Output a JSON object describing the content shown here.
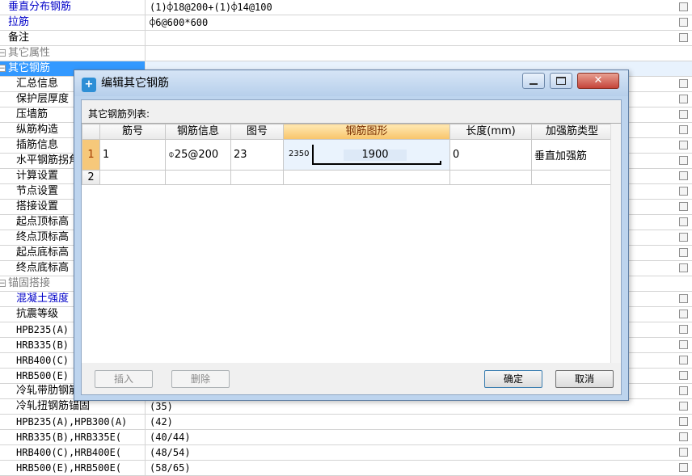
{
  "property_rows": [
    {
      "name": "垂直分布钢筋",
      "value": "(1)⌽18@200+(1)⌽14@100",
      "style": "blue",
      "indent": 10
    },
    {
      "name": "拉筋",
      "value": "⌽6@600*600",
      "style": "blue",
      "indent": 10
    },
    {
      "name": "备注",
      "value": "",
      "style": "",
      "indent": 10
    },
    {
      "name": "其它属性",
      "value": "",
      "style": "grey",
      "indent": 0,
      "toggle": "⊟"
    },
    {
      "name": "其它钢筋",
      "value": "",
      "style": "selected",
      "indent": 0,
      "toggle": "—"
    },
    {
      "name": "汇总信息",
      "value": "",
      "style": "",
      "indent": 20
    },
    {
      "name": "保护层厚度",
      "value": "",
      "style": "",
      "indent": 20
    },
    {
      "name": "压墙筋",
      "value": "",
      "style": "",
      "indent": 20
    },
    {
      "name": "纵筋构造",
      "value": "",
      "style": "",
      "indent": 20
    },
    {
      "name": "插筋信息",
      "value": "",
      "style": "",
      "indent": 20
    },
    {
      "name": "水平钢筋拐角",
      "value": "",
      "style": "",
      "indent": 20
    },
    {
      "name": "计算设置",
      "value": "",
      "style": "",
      "indent": 20
    },
    {
      "name": "节点设置",
      "value": "",
      "style": "",
      "indent": 20
    },
    {
      "name": "搭接设置",
      "value": "",
      "style": "",
      "indent": 20
    },
    {
      "name": "起点顶标高",
      "value": "",
      "style": "",
      "indent": 20
    },
    {
      "name": "终点顶标高",
      "value": "",
      "style": "",
      "indent": 20
    },
    {
      "name": "起点底标高",
      "value": "",
      "style": "",
      "indent": 20
    },
    {
      "name": "终点底标高",
      "value": "",
      "style": "",
      "indent": 20
    },
    {
      "name": "锚固搭接",
      "value": "",
      "style": "grey",
      "indent": 0,
      "toggle": "⊟"
    },
    {
      "name": "混凝土强度",
      "value": "",
      "style": "blue",
      "indent": 20
    },
    {
      "name": "抗震等级",
      "value": "",
      "style": "",
      "indent": 20
    },
    {
      "name": "HPB235(A)",
      "value": "",
      "style": "mono",
      "indent": 20
    },
    {
      "name": "HRB335(B)",
      "value": "",
      "style": "mono",
      "indent": 20
    },
    {
      "name": "HRB400(C)",
      "value": "",
      "style": "mono",
      "indent": 20
    },
    {
      "name": "HRB500(E)",
      "value": "",
      "style": "mono",
      "indent": 20
    },
    {
      "name": "冷轧带肋钢筋",
      "value": "",
      "style": "",
      "indent": 20
    },
    {
      "name": "冷轧扭钢筋锚固",
      "value": "(35)",
      "style": "",
      "indent": 20
    },
    {
      "name": "HPB235(A),HPB300(A)",
      "value": "(42)",
      "style": "mono",
      "indent": 20
    },
    {
      "name": "HRB335(B),HRB335E(",
      "value": "(40/44)",
      "style": "mono",
      "indent": 20
    },
    {
      "name": "HRB400(C),HRB400E(",
      "value": "(48/54)",
      "style": "mono",
      "indent": 20
    },
    {
      "name": "HRB500(E),HRB500E(",
      "value": "(58/65)",
      "style": "mono",
      "indent": 20
    }
  ],
  "dialog": {
    "title": "编辑其它钢筋",
    "list_label": "其它钢筋列表:",
    "columns": [
      "筋号",
      "钢筋信息",
      "图号",
      "钢筋图形",
      "长度(mm)",
      "加强筋类型"
    ],
    "rows": [
      {
        "no": "1",
        "bar_no": "1",
        "rebar_info": "⌽25@200",
        "figure_no": "23",
        "shape_left": "2350",
        "shape_value": "1900",
        "length": "0",
        "type": "垂直加强筋"
      },
      {
        "no": "2",
        "bar_no": "",
        "rebar_info": "",
        "figure_no": "",
        "length": "",
        "type": ""
      }
    ],
    "buttons": {
      "insert": "插入",
      "delete": "删除",
      "ok": "确定",
      "cancel": "取消"
    },
    "window_controls": {
      "close": "✕"
    }
  },
  "colors": {
    "selected_row": "#3399ff",
    "active_column_header": "#f8c46a",
    "dialog_frame": "#bdd4ee"
  }
}
